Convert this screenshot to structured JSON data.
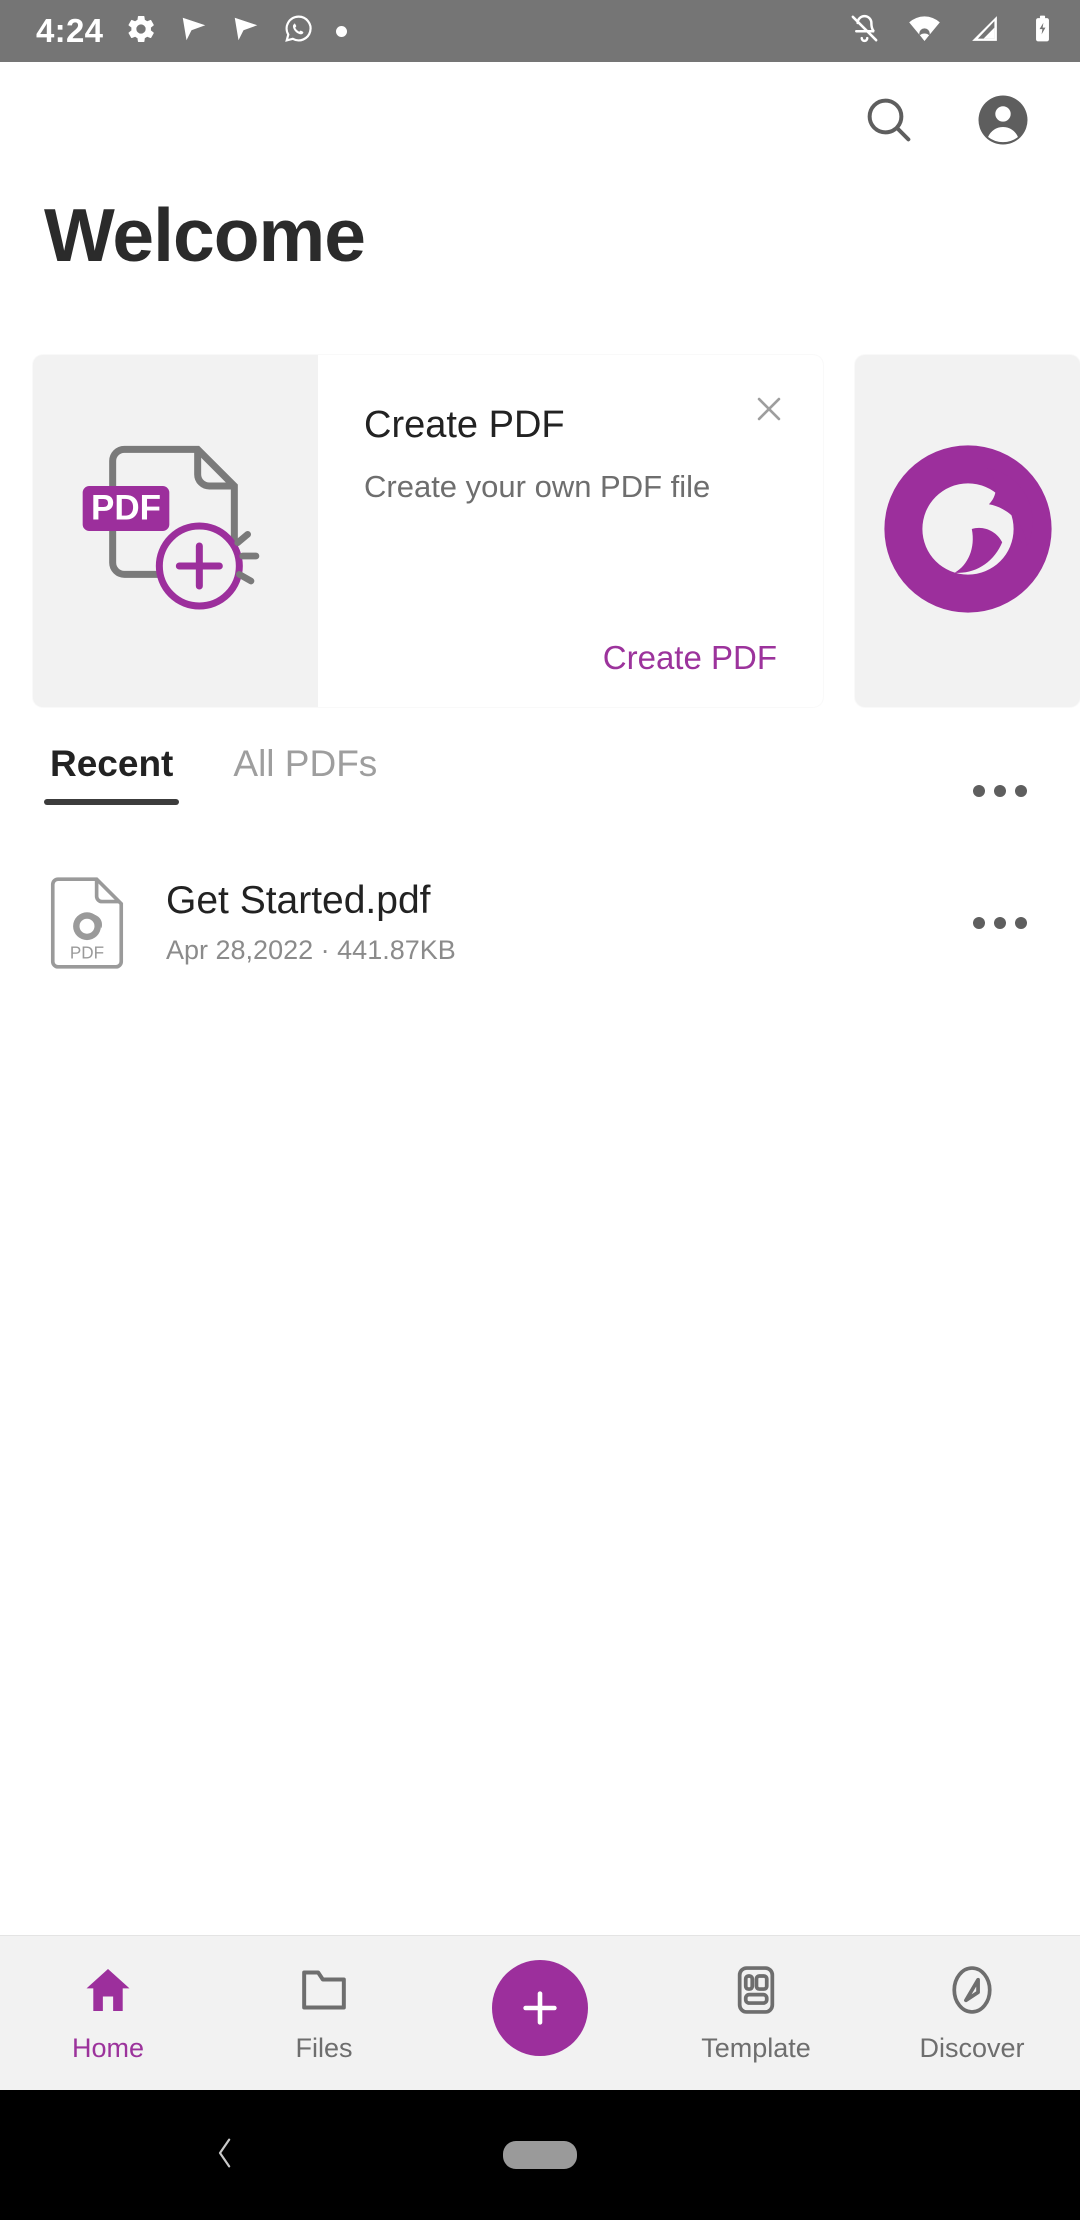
{
  "status_bar": {
    "time": "4:24",
    "left_icons": [
      "settings-gear-icon",
      "send-plane-icon",
      "send-plane-icon",
      "whatsapp-icon",
      "dot-icon"
    ],
    "right_icons": [
      "notifications-off-icon",
      "wifi-icon",
      "cellular-signal-icon",
      "battery-charging-icon"
    ],
    "background_color": "#757575"
  },
  "app_bar": {
    "search_label": "search-icon",
    "account_label": "account-icon"
  },
  "header": {
    "title": "Welcome"
  },
  "promo_cards": [
    {
      "title": "Create PDF",
      "subtitle": "Create your own PDF file",
      "action_label": "Create PDF",
      "icon": "pdf-create-icon",
      "badge_text": "PDF",
      "close_label": "×"
    },
    {
      "icon": "foxit-swirl-logo"
    }
  ],
  "tabs": [
    {
      "label": "Recent",
      "active": true
    },
    {
      "label": "All PDFs",
      "active": false
    }
  ],
  "list_more_label": "more-options",
  "files": [
    {
      "name": "Get Started.pdf",
      "date": "Apr 28,2022",
      "separator": "·",
      "size": "441.87KB",
      "icon_badge": "PDF"
    }
  ],
  "bottom_nav": [
    {
      "label": "Home",
      "icon": "home-icon",
      "active": true
    },
    {
      "label": "Files",
      "icon": "folder-icon",
      "active": false
    },
    {
      "label": "",
      "icon": "plus-icon",
      "active": false,
      "is_fab": true
    },
    {
      "label": "Template",
      "icon": "template-icon",
      "active": false
    },
    {
      "label": "Discover",
      "icon": "compass-icon",
      "active": false
    }
  ],
  "system_nav": {
    "back_label": "back-icon",
    "home_label": "home-pill"
  },
  "colors": {
    "brand_purple": "#9c2f9c",
    "accent_link": "#9c339c",
    "text_primary": "#222222",
    "text_secondary": "#6e6e6e",
    "card_bg": "#f2f2f2",
    "status_bar": "#757575"
  }
}
